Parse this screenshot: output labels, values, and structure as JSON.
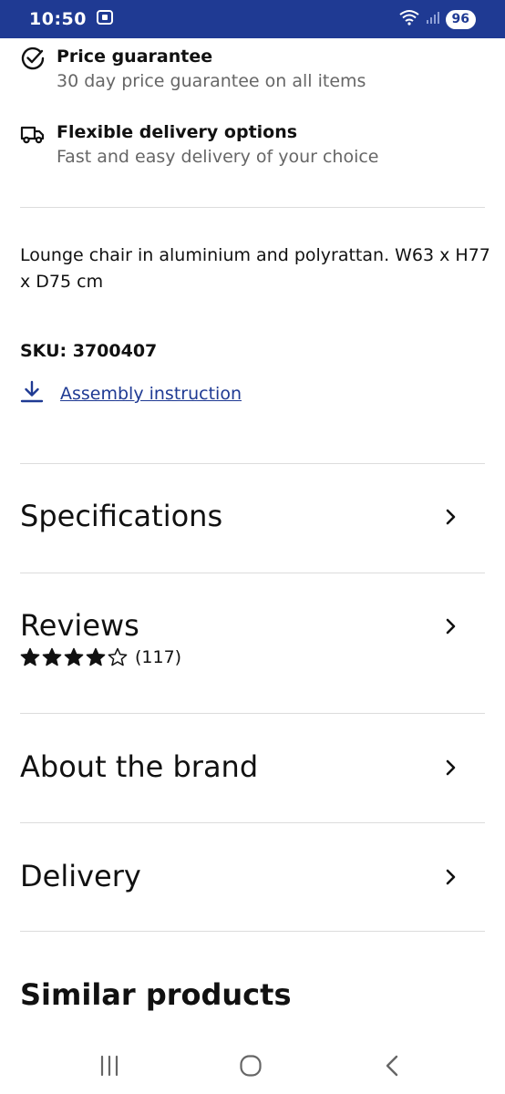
{
  "status_bar": {
    "time": "10:50",
    "battery": "96"
  },
  "benefits": [
    {
      "title": "Price guarantee",
      "subtitle": "30 day price guarantee on all items",
      "icon": "check-circle-icon"
    },
    {
      "title": "Flexible delivery options",
      "subtitle": "Fast and easy delivery of your choice",
      "icon": "truck-icon"
    }
  ],
  "product": {
    "description": "Lounge chair in aluminium and polyrattan. W63 x H77 x D75 cm",
    "sku_label": "SKU:",
    "sku_value": "3700407",
    "assembly_link": "Assembly instruction"
  },
  "sections": {
    "specifications": "Specifications",
    "reviews": "Reviews",
    "about_brand": "About the brand",
    "delivery": "Delivery"
  },
  "reviews": {
    "rating": 4,
    "max_rating": 5,
    "count": "(117)"
  },
  "similar_products": {
    "heading": "Similar products"
  },
  "colors": {
    "status_bar": "#1f3a93",
    "link": "#1f3a93"
  }
}
